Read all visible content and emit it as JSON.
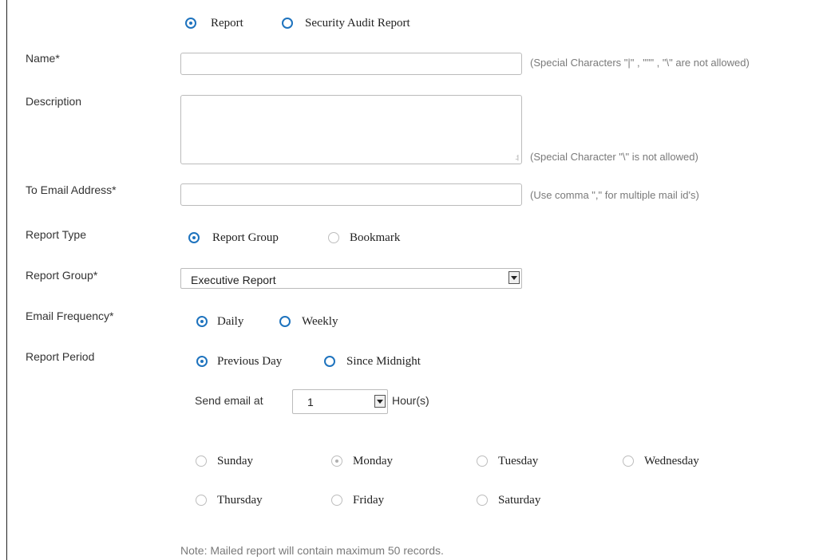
{
  "report_kind": {
    "options": [
      {
        "label": "Report",
        "selected": true
      },
      {
        "label": "Security  Audit  Report",
        "selected": false
      }
    ]
  },
  "fields": {
    "name_label": "Name*",
    "name_value": "",
    "name_hint": "(Special Characters \"|\" , \"\"\" , \"\\\" are not allowed)",
    "description_label": "Description",
    "description_value": "",
    "description_hint": "(Special Character \"\\\" is not allowed)",
    "email_label": "To Email Address*",
    "email_value": "",
    "email_hint": "(Use comma \",\" for multiple mail id's)"
  },
  "report_type": {
    "label": "Report Type",
    "options": [
      {
        "label": "Report  Group",
        "selected": true
      },
      {
        "label": "Bookmark",
        "selected": false
      }
    ]
  },
  "report_group": {
    "label": "Report Group*",
    "selected": "Executive Report"
  },
  "email_frequency": {
    "label": "Email Frequency*",
    "options": [
      {
        "label": "Daily",
        "selected": true
      },
      {
        "label": "Weekly",
        "selected": false
      }
    ]
  },
  "report_period": {
    "label": "Report Period",
    "options": [
      {
        "label": "Previous  Day",
        "selected": true
      },
      {
        "label": "Since  Midnight",
        "selected": false
      }
    ]
  },
  "send_time": {
    "prefix": "Send email at",
    "hour_value": "1",
    "suffix": "Hour(s)"
  },
  "weekdays": [
    {
      "label": "Sunday",
      "selected": false
    },
    {
      "label": "Monday",
      "selected": true
    },
    {
      "label": "Tuesday",
      "selected": false
    },
    {
      "label": "Wednesday",
      "selected": false
    },
    {
      "label": "Thursday",
      "selected": false
    },
    {
      "label": "Friday",
      "selected": false
    },
    {
      "label": "Saturday",
      "selected": false
    }
  ],
  "note": "Note: Mailed report will contain maximum 50 records.",
  "colors": {
    "accent": "#1e73be",
    "hint_text": "#7a7a7a",
    "label_text": "#333333"
  }
}
